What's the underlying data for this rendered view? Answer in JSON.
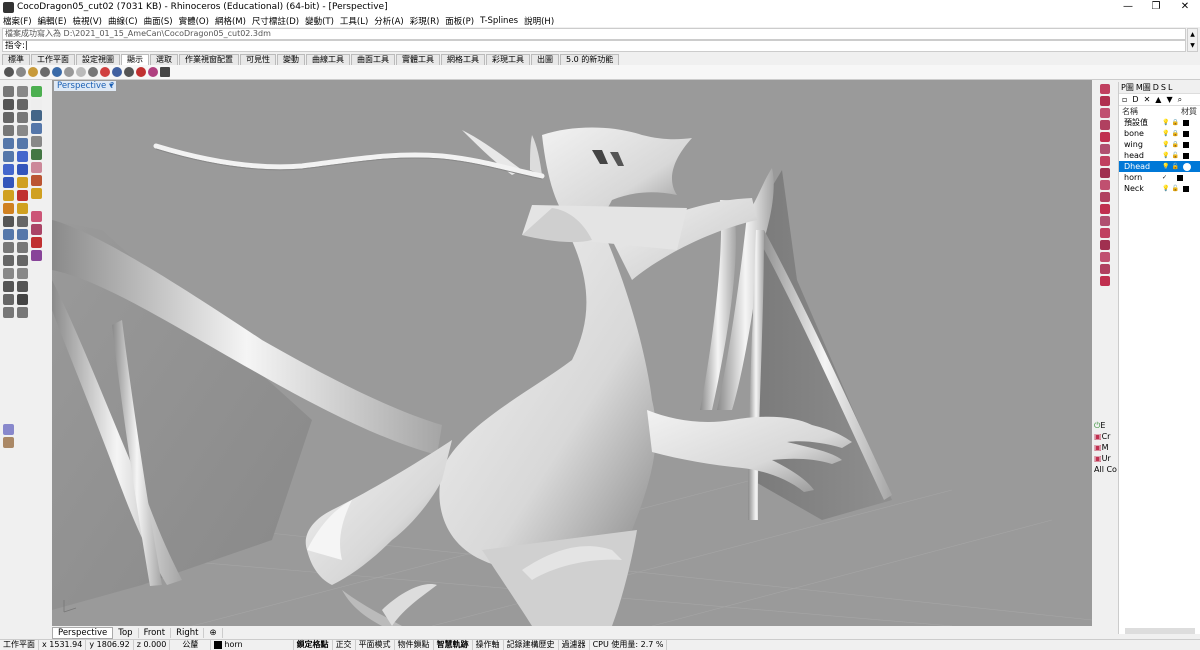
{
  "window": {
    "title": "CocoDragon05_cut02 (7031 KB) - Rhinoceros (Educational) (64-bit) - [Perspective]",
    "controls": {
      "minimize": "—",
      "maximize": "❐",
      "close": "✕"
    }
  },
  "menu": [
    "檔案(F)",
    "編輯(E)",
    "檢視(V)",
    "曲線(C)",
    "曲面(S)",
    "實體(O)",
    "網格(M)",
    "尺寸標註(D)",
    "變動(T)",
    "工具(L)",
    "分析(A)",
    "彩現(R)",
    "面板(P)",
    "T-Splines",
    "說明(H)"
  ],
  "command": {
    "history": "檔案成功寫入為 D:\\2021_01_15_AmeCan\\CocoDragon05_cut02.3dm",
    "prompt": "指令:"
  },
  "toolbar_tabs": {
    "items": [
      "標準",
      "工作平面",
      "設定視圖",
      "顯示",
      "選取",
      "作業視窗配置",
      "可見性",
      "變動",
      "曲線工具",
      "曲面工具",
      "實體工具",
      "網格工具",
      "彩現工具",
      "出圖",
      "5.0 的新功能"
    ],
    "active": "顯示"
  },
  "viewport": {
    "label": "Perspective",
    "menu_marker": "▾",
    "help_marker": "?"
  },
  "viewport_tabs": {
    "items": [
      "Perspective",
      "Top",
      "Front",
      "Right",
      "⊕"
    ],
    "active": "Perspective"
  },
  "layers": {
    "tabs": [
      "P圖",
      "M圖",
      "D",
      "S",
      "L"
    ],
    "columns": {
      "name": "名稱",
      "material": "材質"
    },
    "tools": [
      "▫",
      "D",
      "✕",
      "▲",
      "▼",
      "⌕"
    ],
    "rows": [
      {
        "name": "預設值",
        "check": "",
        "selected": false
      },
      {
        "name": "bone",
        "check": "",
        "selected": false
      },
      {
        "name": "wing",
        "check": "",
        "selected": false
      },
      {
        "name": "head",
        "check": "",
        "selected": false
      },
      {
        "name": "Dhead",
        "check": "",
        "selected": true
      },
      {
        "name": "horn",
        "check": "✓",
        "selected": false
      },
      {
        "name": "Neck",
        "check": "",
        "selected": false
      }
    ]
  },
  "display_props": [
    {
      "icon": "⏻",
      "label": "E"
    },
    {
      "icon": "▣",
      "label": "Cr"
    },
    {
      "icon": "▣",
      "label": "M"
    },
    {
      "icon": "▣",
      "label": "Ur"
    },
    {
      "icon": "",
      "label": "All Co"
    }
  ],
  "status": {
    "cplane": "工作平面",
    "x": "x 1531.94",
    "y": "y 1806.92",
    "z": "z 0.000",
    "units": "公釐",
    "layer": "horn",
    "grid_snap": "鎖定格點",
    "ortho": "正交",
    "planar": "平面模式",
    "osnap": "物件鎖點",
    "smarttrack": "智慧軌跡",
    "gumball": "操作軸",
    "history": "記錄建構歷史",
    "filter": "過濾器",
    "cpu": "CPU 使用量: 2.7 %"
  },
  "colors": {
    "viewport_bg": "#9a9a9a",
    "selection": "#0078d7",
    "active_label": "#1a5fb4"
  }
}
